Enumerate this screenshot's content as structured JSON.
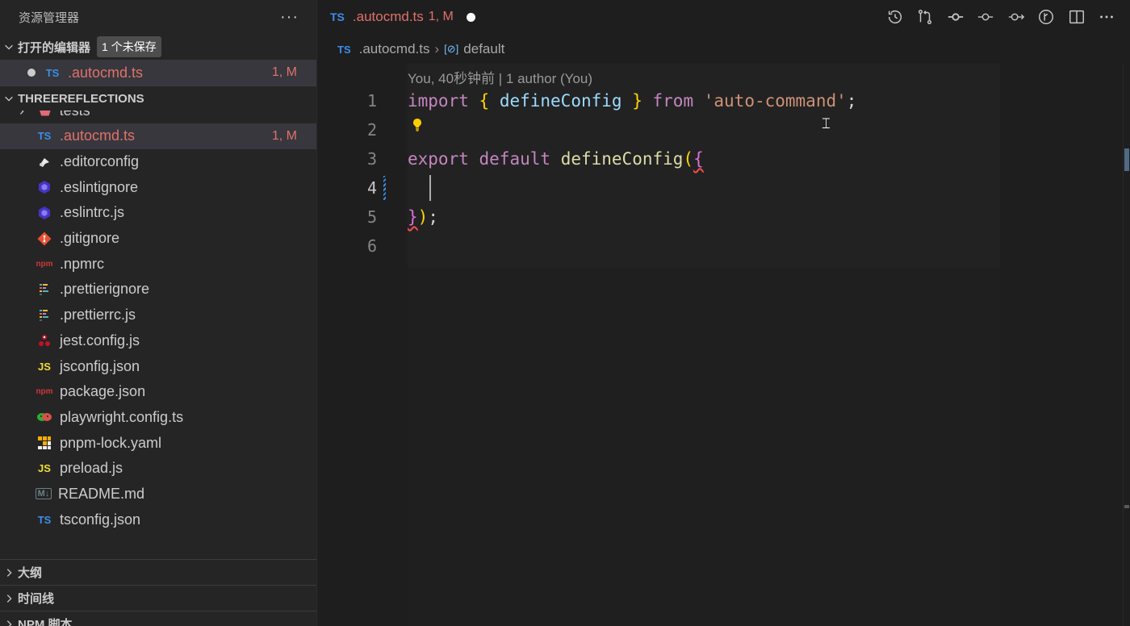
{
  "sidebar": {
    "title": "资源管理器",
    "more": "···",
    "open_editors": {
      "label": "打开的编辑器",
      "badge": "1 个未保存",
      "files": [
        {
          "icon": "TS",
          "name": ".autocmd.ts",
          "status": "1, M"
        }
      ]
    },
    "project": {
      "label": "THREEREFLECTIONS",
      "partial_folder": "tests",
      "files": [
        {
          "icon": "typescript-icon",
          "glyph": "TS",
          "name": ".autocmd.ts",
          "status": "1, M"
        },
        {
          "icon": "editorconfig-icon",
          "glyph": "",
          "name": ".editorconfig",
          "status": ""
        },
        {
          "icon": "eslint-icon",
          "glyph": "",
          "name": ".eslintignore",
          "status": ""
        },
        {
          "icon": "eslint-icon",
          "glyph": "",
          "name": ".eslintrc.js",
          "status": ""
        },
        {
          "icon": "git-icon",
          "glyph": "",
          "name": ".gitignore",
          "status": ""
        },
        {
          "icon": "npm-icon",
          "glyph": "npm",
          "name": ".npmrc",
          "status": ""
        },
        {
          "icon": "prettier-icon",
          "glyph": "",
          "name": ".prettierignore",
          "status": ""
        },
        {
          "icon": "prettier-icon",
          "glyph": "",
          "name": ".prettierrc.js",
          "status": ""
        },
        {
          "icon": "jest-icon",
          "glyph": "",
          "name": "jest.config.js",
          "status": ""
        },
        {
          "icon": "javascript-icon",
          "glyph": "JS",
          "name": "jsconfig.json",
          "status": ""
        },
        {
          "icon": "npm-icon",
          "glyph": "npm",
          "name": "package.json",
          "status": ""
        },
        {
          "icon": "playwright-icon",
          "glyph": "",
          "name": "playwright.config.ts",
          "status": ""
        },
        {
          "icon": "pnpm-icon",
          "glyph": "",
          "name": "pnpm-lock.yaml",
          "status": ""
        },
        {
          "icon": "javascript-icon",
          "glyph": "JS",
          "name": "preload.js",
          "status": ""
        },
        {
          "icon": "markdown-icon",
          "glyph": "M↓",
          "name": "README.md",
          "status": ""
        },
        {
          "icon": "tsconfig-icon",
          "glyph": "TS",
          "name": "tsconfig.json",
          "status": ""
        }
      ]
    },
    "bottom_sections": [
      "大纲",
      "时间线",
      "NPM 脚本"
    ]
  },
  "editor": {
    "tab": {
      "icon": "TS",
      "name": ".autocmd.ts",
      "status": "1, M"
    },
    "actions": [
      "history-icon",
      "compare-changes-icon",
      "git-commit-icon",
      "git-previous-icon",
      "git-next-icon",
      "gitlens-icon",
      "split-editor-icon",
      "more-actions-icon"
    ],
    "breadcrumb": {
      "icon": "TS",
      "file": ".autocmd.ts",
      "symbol": "default"
    },
    "codelens": "You, 40秒钟前 | 1 author (You)",
    "line_numbers": [
      "1",
      "2",
      "3",
      "4",
      "5",
      "6"
    ],
    "code": {
      "l1": {
        "import": "import",
        "ob": "{",
        "name": "defineConfig",
        "cb": "}",
        "from": "from",
        "module": "'auto-command'",
        "semi": ";"
      },
      "l3": {
        "export": "export",
        "default": "default",
        "fn": "defineConfig",
        "paren": "(",
        "brace": "{"
      },
      "l5": {
        "brace": "}",
        "paren": ")",
        "semi": ";"
      }
    }
  },
  "colors": {
    "keyword": "#c586c0",
    "function": "#dcdcaa",
    "identifier": "#9cdcfe",
    "string": "#ce9178",
    "modified": "#e0716a",
    "ts_blue": "#3b8eea"
  }
}
